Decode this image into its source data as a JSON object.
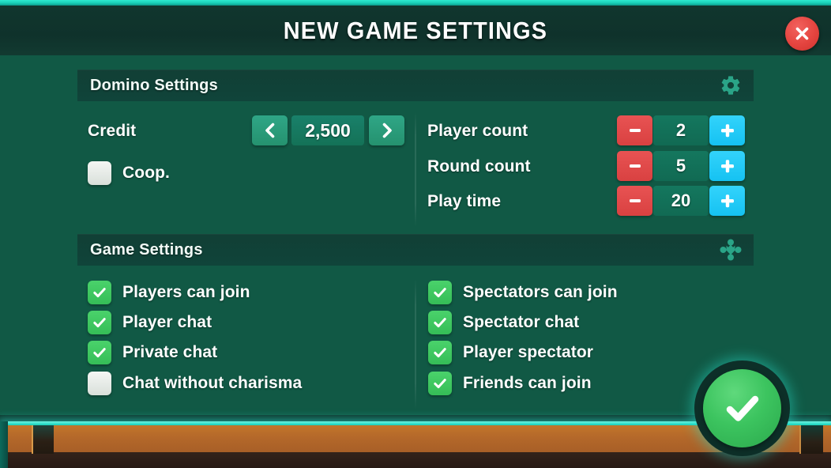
{
  "header": {
    "title": "NEW GAME SETTINGS",
    "close_icon": "close-x-icon"
  },
  "colors": {
    "background": "#115945",
    "header_bar": "#11362e",
    "neon_accent": "#29dcc6",
    "section_bar": "#113f35",
    "teal_button": "#2fa686",
    "minus_red": "#e04545",
    "plus_cyan": "#1fc8f5",
    "checkbox_on": "#3cc45f",
    "checkbox_off": "#eef1ee",
    "close_red": "#e4443f",
    "confirm_green": "#3cc45f",
    "wood": "#b4682a"
  },
  "domino_settings": {
    "title": "Domino Settings",
    "icon": "gear-icon",
    "credit": {
      "label": "Credit",
      "value": "2,500",
      "prev_icon": "chevron-left-icon",
      "next_icon": "chevron-right-icon"
    },
    "coop": {
      "label": "Coop.",
      "checked": false
    },
    "steppers": [
      {
        "label": "Player count",
        "value": "2",
        "minus_icon": "minus-icon",
        "plus_icon": "plus-icon"
      },
      {
        "label": "Round count",
        "value": "5",
        "minus_icon": "minus-icon",
        "plus_icon": "plus-icon"
      },
      {
        "label": "Play time",
        "value": "20",
        "minus_icon": "minus-icon",
        "plus_icon": "plus-icon"
      }
    ]
  },
  "game_settings": {
    "title": "Game Settings",
    "icon": "cog-lobes-icon",
    "left_column": [
      {
        "label": "Players can join",
        "checked": true
      },
      {
        "label": "Player chat",
        "checked": true
      },
      {
        "label": "Private chat",
        "checked": true
      },
      {
        "label": "Chat without charisma",
        "checked": false
      }
    ],
    "right_column": [
      {
        "label": "Spectators can join",
        "checked": true
      },
      {
        "label": "Spectator chat",
        "checked": true
      },
      {
        "label": "Player spectator",
        "checked": true
      },
      {
        "label": "Friends can join",
        "checked": true
      }
    ]
  },
  "confirm": {
    "icon": "checkmark-icon"
  }
}
